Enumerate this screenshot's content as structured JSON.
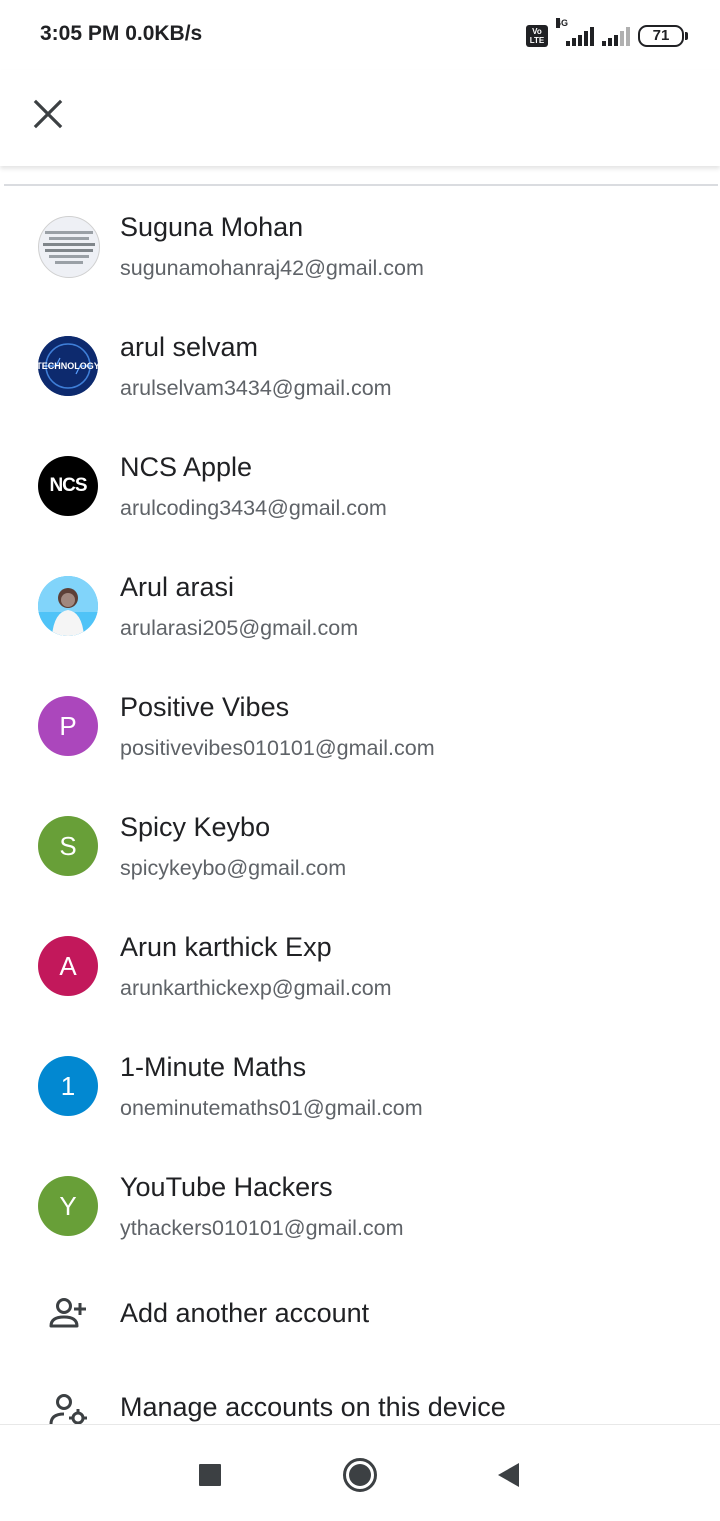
{
  "status_bar": {
    "time_speed": "3:05 PM  0.0KB/s",
    "volte_label": "Vo LTE",
    "network_label": "4G",
    "battery": "71"
  },
  "colors": {
    "name_text": "#202124",
    "email_text": "#5f6368",
    "avatar_purple": "#ab47bc",
    "avatar_green": "#689f38",
    "avatar_magenta": "#c2185b",
    "avatar_blue": "#0288d1"
  },
  "accounts": [
    {
      "name": "Suguna Mohan",
      "email": "sugunamohanraj42@gmail.com",
      "avatar_type": "photo",
      "avatar_text": "First Law of Thermodynamics"
    },
    {
      "name": "arul selvam",
      "email": "arulselvam3434@gmail.com",
      "avatar_type": "logo",
      "avatar_text": "TECHNOLOGY"
    },
    {
      "name": "NCS Apple",
      "email": "arulcoding3434@gmail.com",
      "avatar_type": "logo",
      "avatar_text": "NCS"
    },
    {
      "name": "Arul arasi",
      "email": "arularasi205@gmail.com",
      "avatar_type": "photo"
    },
    {
      "name": "Positive Vibes",
      "email": "positivevibes010101@gmail.com",
      "avatar_type": "letter",
      "avatar_text": "P",
      "avatar_color": "#ab47bc"
    },
    {
      "name": "Spicy Keybo",
      "email": "spicykeybo@gmail.com",
      "avatar_type": "letter",
      "avatar_text": "S",
      "avatar_color": "#689f38"
    },
    {
      "name": "Arun karthick Exp",
      "email": "arunkarthickexp@gmail.com",
      "avatar_type": "letter",
      "avatar_text": "A",
      "avatar_color": "#c2185b"
    },
    {
      "name": "1-Minute Maths",
      "email": "oneminutemaths01@gmail.com",
      "avatar_type": "letter",
      "avatar_text": "1",
      "avatar_color": "#0288d1"
    },
    {
      "name": "YouTube Hackers",
      "email": "ythackers010101@gmail.com",
      "avatar_type": "letter",
      "avatar_text": "Y",
      "avatar_color": "#689f38"
    }
  ],
  "actions": {
    "add_account": "Add another account",
    "manage_accounts": "Manage accounts on this device"
  },
  "icons": {
    "close": "close-icon",
    "add_account": "person-add-icon",
    "manage_accounts": "manage-accounts-icon",
    "nav_recents": "square-icon",
    "nav_home": "circle-icon",
    "nav_back": "triangle-back-icon"
  }
}
